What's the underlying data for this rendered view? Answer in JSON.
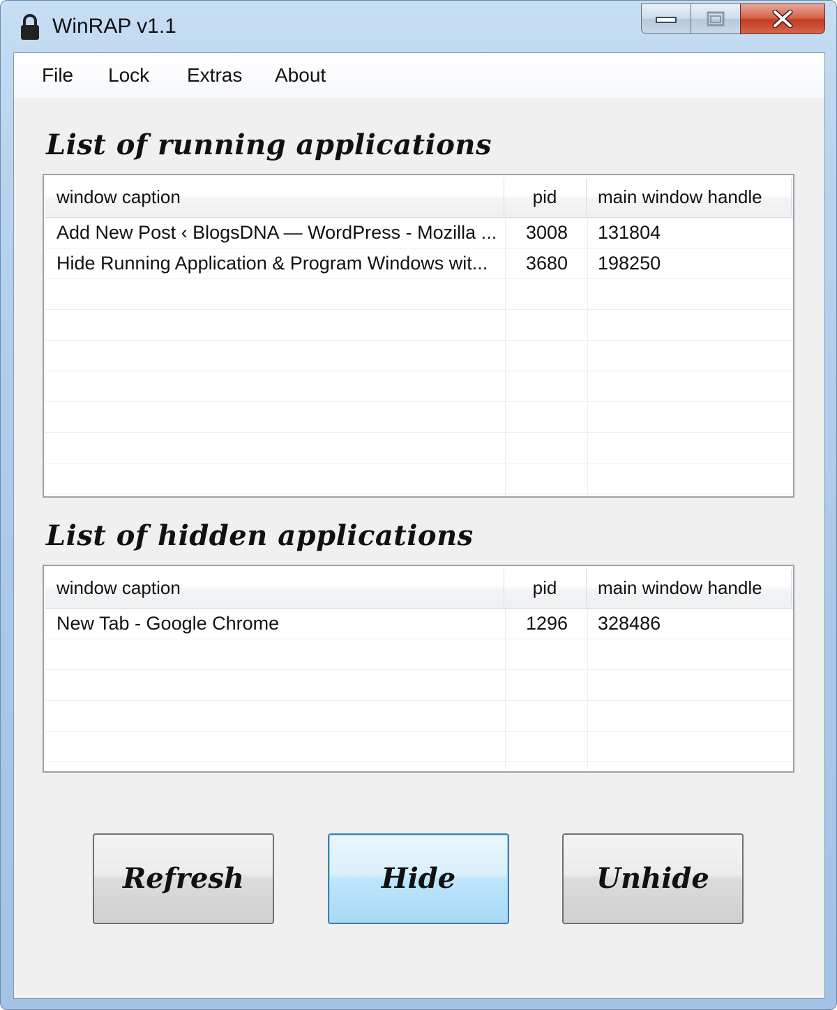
{
  "window": {
    "title": "WinRAP v1.1"
  },
  "menu": {
    "items": [
      "File",
      "Lock",
      "Extras",
      "About"
    ]
  },
  "running": {
    "title": "List of running applications",
    "columns": {
      "caption": "window caption",
      "pid": "pid",
      "handle": "main window handle"
    },
    "rows": [
      {
        "caption": "Add New Post ‹ BlogsDNA — WordPress - Mozilla ...",
        "pid": "3008",
        "handle": "131804"
      },
      {
        "caption": "Hide Running Application & Program Windows wit...",
        "pid": "3680",
        "handle": "198250"
      }
    ]
  },
  "hidden": {
    "title": "List of hidden applications",
    "columns": {
      "caption": "window caption",
      "pid": "pid",
      "handle": "main window handle"
    },
    "rows": [
      {
        "caption": "New Tab - Google Chrome",
        "pid": "1296",
        "handle": "328486"
      }
    ]
  },
  "buttons": {
    "refresh": "Refresh",
    "hide": "Hide",
    "unhide": "Unhide"
  },
  "icons": {
    "app": "lock-icon",
    "minimize": "minimize-icon",
    "maximize": "maximize-icon",
    "close": "close-icon"
  },
  "colors": {
    "titlebar": "#b7d3ee",
    "close": "#c23a22",
    "focus_border": "#3c7fb1"
  }
}
